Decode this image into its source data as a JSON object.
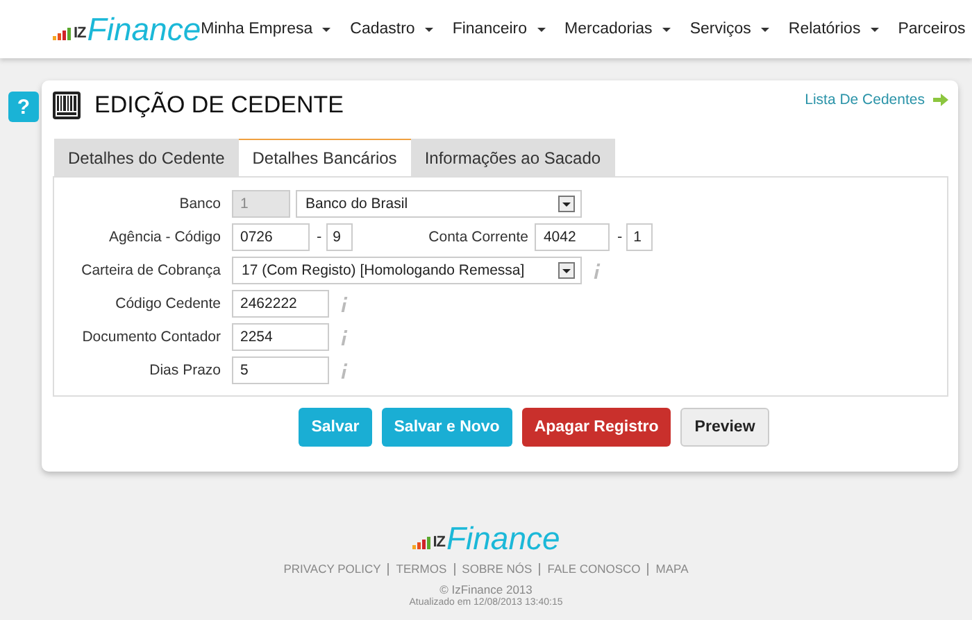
{
  "header": {
    "logo": {
      "prefix": "IZ",
      "name": "Finance"
    },
    "nav": [
      {
        "label": "Minha Empresa"
      },
      {
        "label": "Cadastro"
      },
      {
        "label": "Financeiro"
      },
      {
        "label": "Mercadorias"
      },
      {
        "label": "Serviços"
      },
      {
        "label": "Relatórios"
      },
      {
        "label": "Parceiros"
      }
    ]
  },
  "help_button": {
    "label": "?"
  },
  "page": {
    "title": "EDIÇÃO DE CEDENTE",
    "list_link": "Lista De Cedentes"
  },
  "tabs": [
    {
      "label": "Detalhes do Cedente",
      "selected": false
    },
    {
      "label": "Detalhes Bancários",
      "selected": true
    },
    {
      "label": "Informações ao Sacado",
      "selected": false
    }
  ],
  "fields": [
    {
      "kind": "code_select",
      "label": "Banco",
      "code": "1",
      "value": "Banco do Brasil",
      "info": false
    },
    {
      "kind": "pair",
      "label": "Agência - Código",
      "value": "0726",
      "separator": "-",
      "digit": "9",
      "label2": "Conta Corrente",
      "value2": "4042",
      "separator2": "-",
      "digit2": "1",
      "info": false
    },
    {
      "kind": "select",
      "label": "Carteira de Cobrança",
      "value": "17 (Com Registo) [Homologando Remessa]",
      "info": true
    },
    {
      "kind": "text",
      "label": "Código Cedente",
      "value": "2462222",
      "info": true
    },
    {
      "kind": "text",
      "label": "Documento Contador",
      "value": "2254",
      "info": true
    },
    {
      "kind": "text",
      "label": "Dias Prazo",
      "value": "5",
      "info": true
    }
  ],
  "buttons": [
    {
      "label": "Salvar",
      "kind": "primary"
    },
    {
      "label": "Salvar e Novo",
      "kind": "primary"
    },
    {
      "label": "Apagar Registro",
      "kind": "danger"
    },
    {
      "label": "Preview",
      "kind": "default"
    }
  ],
  "footer": {
    "logo": {
      "prefix": "IZ",
      "name": "Finance"
    },
    "links": [
      {
        "label": "PRIVACY POLICY"
      },
      {
        "label": "TERMOS"
      },
      {
        "label": "SOBRE NÓS"
      },
      {
        "label": "FALE CONOSCO"
      },
      {
        "label": "MAPA"
      }
    ],
    "copyright": "© IzFinance 2013",
    "updated": "Atualizado em 12/08/2013 13:40:15"
  }
}
